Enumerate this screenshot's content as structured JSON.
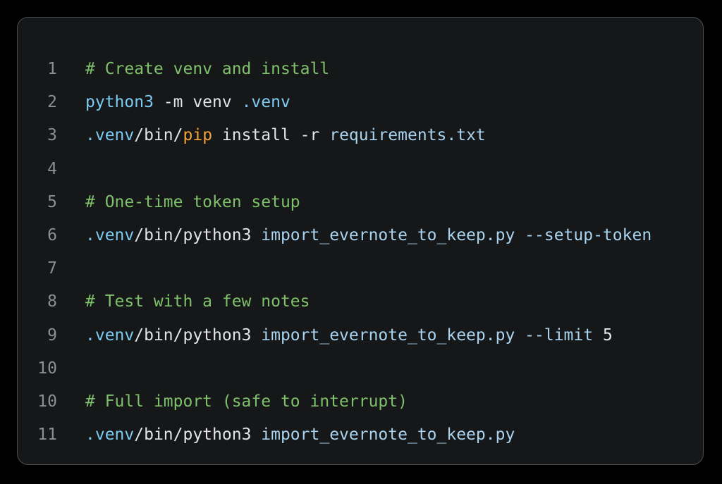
{
  "colors": {
    "background": "#000000",
    "panel": "#161719",
    "panel_border": "#4a4c50",
    "line_number": "#8b8e93",
    "comment": "#7ec16a",
    "command": "#7ccbf2",
    "plain": "#e3e4e6",
    "path": "#a9d3ee",
    "pip": "#f3a235"
  },
  "code": {
    "lines": [
      {
        "number": "1",
        "tokens": [
          {
            "text": "# Create venv and install",
            "kind": "comment"
          }
        ]
      },
      {
        "number": "2",
        "tokens": [
          {
            "text": "python3",
            "kind": "cmd"
          },
          {
            "text": " -m venv ",
            "kind": "plain"
          },
          {
            "text": ".venv",
            "kind": "cmd"
          }
        ]
      },
      {
        "number": "3",
        "tokens": [
          {
            "text": ".venv",
            "kind": "cmd"
          },
          {
            "text": "/bin/",
            "kind": "plain"
          },
          {
            "text": "pip",
            "kind": "pip"
          },
          {
            "text": " install -r ",
            "kind": "plain"
          },
          {
            "text": "requirements.txt",
            "kind": "path"
          }
        ]
      },
      {
        "number": "4",
        "tokens": []
      },
      {
        "number": "5",
        "tokens": [
          {
            "text": "# One-time token setup",
            "kind": "comment"
          }
        ]
      },
      {
        "number": "6",
        "tokens": [
          {
            "text": ".venv",
            "kind": "cmd"
          },
          {
            "text": "/bin/python3 ",
            "kind": "plain"
          },
          {
            "text": "import_evernote_to_keep.py",
            "kind": "path"
          },
          {
            "text": " ",
            "kind": "plain"
          },
          {
            "text": "--setup-token",
            "kind": "path"
          }
        ]
      },
      {
        "number": "7",
        "tokens": []
      },
      {
        "number": "8",
        "tokens": [
          {
            "text": "# Test with a few notes",
            "kind": "comment"
          }
        ]
      },
      {
        "number": "9",
        "tokens": [
          {
            "text": ".venv",
            "kind": "cmd"
          },
          {
            "text": "/bin/python3 ",
            "kind": "plain"
          },
          {
            "text": "import_evernote_to_keep.py",
            "kind": "path"
          },
          {
            "text": " ",
            "kind": "plain"
          },
          {
            "text": "--limit",
            "kind": "path"
          },
          {
            "text": " 5",
            "kind": "plain"
          }
        ]
      },
      {
        "number": "10",
        "tokens": []
      },
      {
        "number": "10",
        "tokens": [
          {
            "text": "# Full import (safe to interrupt)",
            "kind": "comment"
          }
        ]
      },
      {
        "number": "11",
        "tokens": [
          {
            "text": ".venv",
            "kind": "cmd"
          },
          {
            "text": "/bin/python3 ",
            "kind": "plain"
          },
          {
            "text": "import_evernote_to_keep.py",
            "kind": "path"
          }
        ]
      }
    ]
  }
}
